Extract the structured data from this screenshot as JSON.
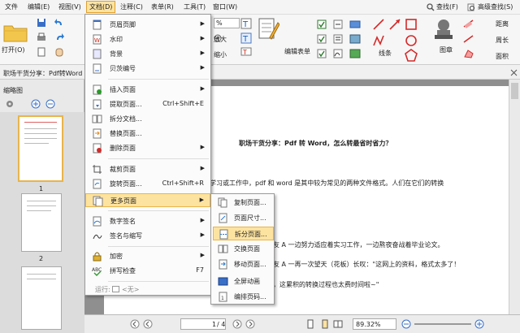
{
  "menubar": {
    "items": [
      "文件",
      "编辑(E)",
      "视图(V)",
      "文档(D)",
      "注释(C)",
      "表单(R)",
      "工具(T)",
      "窗口(W)"
    ],
    "find": "查找(F)",
    "advanced_find": "高级查找(S)"
  },
  "ribbon": {
    "open_label": "打开(O)",
    "zoom_value": "%",
    "enlarge_label": "放大",
    "shrink_label": "缩小",
    "edit_form_label": "编辑表单",
    "lines_label": "线条",
    "stamp_label": "图章",
    "distance_label": "距离",
    "perimeter_label": "周长",
    "area_label": "面积"
  },
  "doc_tab": {
    "title": "职场干货分享：Pdf转Word"
  },
  "left_panel": {
    "title": "缩略图",
    "page_labels": [
      "1",
      "2"
    ]
  },
  "document": {
    "heading": "职场干货分享：Pdf 转 Word，怎么转最省时省力？",
    "line1": "学习或工作中，pdf 和 word 是其中较为常见的两种文件格式。人们在它们的转换",
    "line2": "。",
    "line3": "友 A 一边努力适应着实习工作，一边熬夜奋战着毕业论文。",
    "line4": "友 A 一再一次望天（花板）长叹：\"这网上的资料，格式太多了！",
    "line5": "，这累积的转换过程也太费时间啦~\""
  },
  "status": {
    "page": "1",
    "page_total": "/ 4",
    "zoom": "89.32%"
  },
  "doc_menu": {
    "items": [
      {
        "label": "页眉页脚",
        "shortcut": "",
        "submenu": true
      },
      {
        "label": "水印",
        "shortcut": "",
        "submenu": true
      },
      {
        "label": "背景",
        "shortcut": "",
        "submenu": true
      },
      {
        "label": "贝茨编号",
        "shortcut": "",
        "submenu": true
      },
      {
        "label": "插入页面",
        "shortcut": "",
        "submenu": true
      },
      {
        "label": "提取页面...",
        "shortcut": "Ctrl+Shift+E",
        "submenu": false
      },
      {
        "label": "拆分文档...",
        "shortcut": "",
        "submenu": false
      },
      {
        "label": "替换页面...",
        "shortcut": "",
        "submenu": false
      },
      {
        "label": "删除页面",
        "shortcut": "",
        "submenu": true
      },
      {
        "label": "裁剪页面",
        "shortcut": "",
        "submenu": true
      },
      {
        "label": "旋转页面...",
        "shortcut": "Ctrl+Shift+R",
        "submenu": false
      },
      {
        "label": "更多页面",
        "shortcut": "",
        "submenu": true
      },
      {
        "label": "数字签名",
        "shortcut": "",
        "submenu": true
      },
      {
        "label": "签名与缩写",
        "shortcut": "",
        "submenu": true
      },
      {
        "label": "加密",
        "shortcut": "",
        "submenu": true
      },
      {
        "label": "拼写检查",
        "shortcut": "F7",
        "submenu": false
      }
    ],
    "run_label": "运行:",
    "run_value": "<无>"
  },
  "more_pages_menu": {
    "items": [
      "复制页面...",
      "页面尺寸...",
      "拆分页面...",
      "交换页面",
      "移动页面...",
      "全屏动画",
      "编排页码..."
    ]
  },
  "colors": {
    "highlight": "#fde3a0",
    "highlight_border": "#e8b44c",
    "accent_red": "#d42a2a"
  }
}
